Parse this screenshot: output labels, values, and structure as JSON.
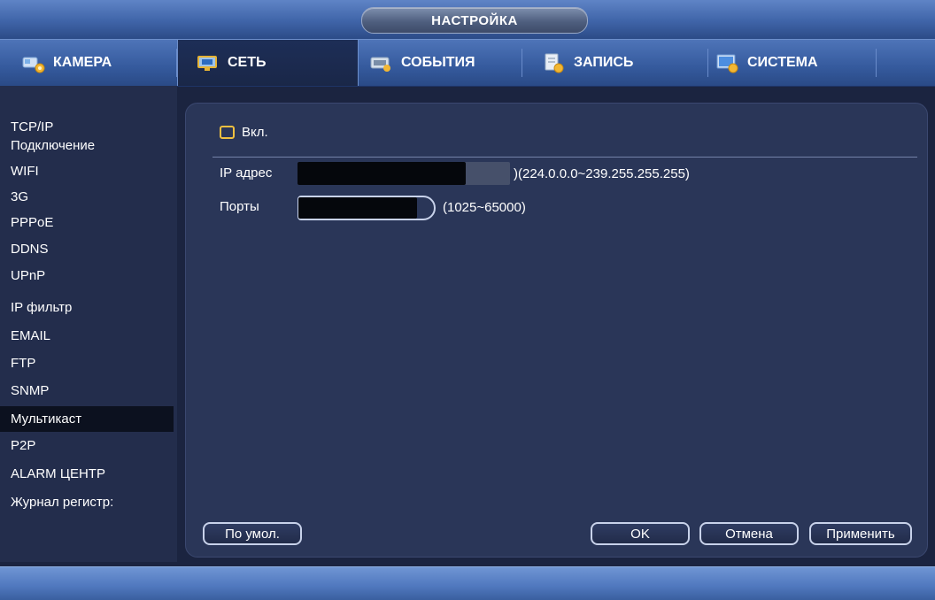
{
  "window": {
    "title": "НАСТРОЙКА"
  },
  "tabs": [
    {
      "label": "КАМЕРА",
      "icon": "camera-icon"
    },
    {
      "label": "СЕТЬ",
      "icon": "network-icon",
      "active": true
    },
    {
      "label": "СОБЫТИЯ",
      "icon": "events-icon"
    },
    {
      "label": "ЗАПИСЬ",
      "icon": "record-icon"
    },
    {
      "label": "СИСТЕМА",
      "icon": "system-icon"
    }
  ],
  "sidebar": {
    "items": [
      {
        "label": "TCP/IP"
      },
      {
        "label": "Подключение"
      },
      {
        "label": "WIFI"
      },
      {
        "label": "3G"
      },
      {
        "label": "PPPoE"
      },
      {
        "label": "DDNS"
      },
      {
        "label": "UPnP"
      },
      {
        "label": "IP фильтр"
      },
      {
        "label": "EMAIL"
      },
      {
        "label": "FTP"
      },
      {
        "label": "SNMP"
      },
      {
        "label": "Мультикаст",
        "selected": true
      },
      {
        "label": "P2P"
      },
      {
        "label": "ALARM ЦЕНТР"
      },
      {
        "label": "Журнал регистр:"
      }
    ]
  },
  "form": {
    "enable_label": "Вкл.",
    "enabled": false,
    "ip_label": "IP адрес",
    "ip_value": "",
    "ip_range": ")(224.0.0.0~239.255.255.255)",
    "port_label": "Порты",
    "port_value": "",
    "port_range": "(1025~65000)"
  },
  "buttons": {
    "default": "По умол.",
    "ok": "OK",
    "cancel": "Отмена",
    "apply": "Применить"
  },
  "colors": {
    "accent_checkbox": "#f0c040",
    "panel_bg": "#2a3658",
    "selected_menu_bg": "#0c111f"
  }
}
